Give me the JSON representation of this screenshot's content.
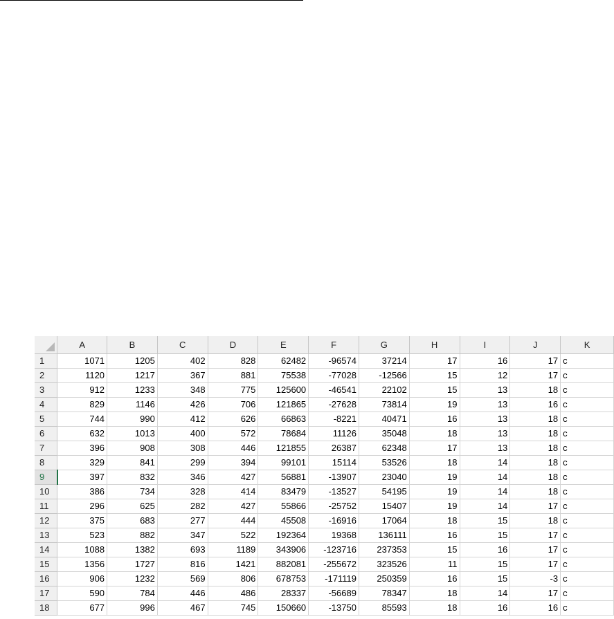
{
  "columns": [
    "A",
    "B",
    "C",
    "D",
    "E",
    "F",
    "G",
    "H",
    "I",
    "J",
    "K"
  ],
  "selected_row": "9",
  "rows": [
    {
      "n": "1",
      "cells": [
        "1071",
        "1205",
        "402",
        "828",
        "62482",
        "-96574",
        "37214",
        "17",
        "16",
        "17",
        "c"
      ]
    },
    {
      "n": "2",
      "cells": [
        "1120",
        "1217",
        "367",
        "881",
        "75538",
        "-77028",
        "-12566",
        "15",
        "12",
        "17",
        "c"
      ]
    },
    {
      "n": "3",
      "cells": [
        "912",
        "1233",
        "348",
        "775",
        "125600",
        "-46541",
        "22102",
        "15",
        "13",
        "18",
        "c"
      ]
    },
    {
      "n": "4",
      "cells": [
        "829",
        "1146",
        "426",
        "706",
        "121865",
        "-27628",
        "73814",
        "19",
        "13",
        "16",
        "c"
      ]
    },
    {
      "n": "5",
      "cells": [
        "744",
        "990",
        "412",
        "626",
        "66863",
        "-8221",
        "40471",
        "16",
        "13",
        "18",
        "c"
      ]
    },
    {
      "n": "6",
      "cells": [
        "632",
        "1013",
        "400",
        "572",
        "78684",
        "11126",
        "35048",
        "18",
        "13",
        "18",
        "c"
      ]
    },
    {
      "n": "7",
      "cells": [
        "396",
        "908",
        "308",
        "446",
        "121855",
        "26387",
        "62348",
        "17",
        "13",
        "18",
        "c"
      ]
    },
    {
      "n": "8",
      "cells": [
        "329",
        "841",
        "299",
        "394",
        "99101",
        "15114",
        "53526",
        "18",
        "14",
        "18",
        "c"
      ]
    },
    {
      "n": "9",
      "cells": [
        "397",
        "832",
        "346",
        "427",
        "56881",
        "-13907",
        "23040",
        "19",
        "14",
        "18",
        "c"
      ]
    },
    {
      "n": "10",
      "cells": [
        "386",
        "734",
        "328",
        "414",
        "83479",
        "-13527",
        "54195",
        "19",
        "14",
        "18",
        "c"
      ]
    },
    {
      "n": "11",
      "cells": [
        "296",
        "625",
        "282",
        "427",
        "55866",
        "-25752",
        "15407",
        "19",
        "14",
        "17",
        "c"
      ]
    },
    {
      "n": "12",
      "cells": [
        "375",
        "683",
        "277",
        "444",
        "45508",
        "-16916",
        "17064",
        "18",
        "15",
        "18",
        "c"
      ]
    },
    {
      "n": "13",
      "cells": [
        "523",
        "882",
        "347",
        "522",
        "192364",
        "19368",
        "136111",
        "16",
        "15",
        "17",
        "c"
      ]
    },
    {
      "n": "14",
      "cells": [
        "1088",
        "1382",
        "693",
        "1189",
        "343906",
        "-123716",
        "237353",
        "15",
        "16",
        "17",
        "c"
      ]
    },
    {
      "n": "15",
      "cells": [
        "1356",
        "1727",
        "816",
        "1421",
        "882081",
        "-255672",
        "323526",
        "11",
        "15",
        "17",
        "c"
      ]
    },
    {
      "n": "16",
      "cells": [
        "906",
        "1232",
        "569",
        "806",
        "678753",
        "-171119",
        "250359",
        "16",
        "15",
        "-3",
        "c"
      ]
    },
    {
      "n": "17",
      "cells": [
        "590",
        "784",
        "446",
        "486",
        "28337",
        "-56689",
        "78347",
        "18",
        "14",
        "17",
        "c"
      ]
    },
    {
      "n": "18",
      "cells": [
        "677",
        "996",
        "467",
        "745",
        "150660",
        "-13750",
        "85593",
        "18",
        "16",
        "16",
        "c"
      ]
    }
  ]
}
